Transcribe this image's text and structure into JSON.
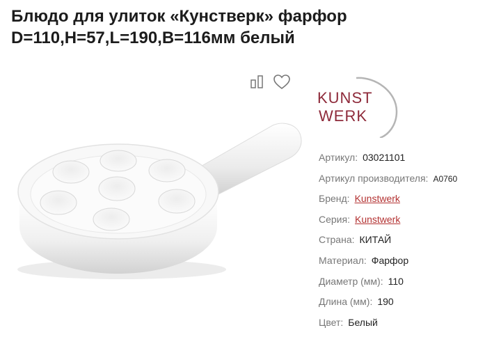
{
  "product": {
    "title": "Блюдо для улиток «Кунстверк» фарфор D=110,H=57,L=190,B=116мм белый"
  },
  "actions": {
    "compare_icon": "compare-icon",
    "favorite_icon": "heart-icon"
  },
  "brand_logo": {
    "line1": "KUNST",
    "line2": "WERK",
    "color": "#8e2a3a"
  },
  "specs": {
    "article": {
      "label": "Артикул:",
      "value": "03021101"
    },
    "manufacturer_article": {
      "label": "Артикул производителя:",
      "value": "A0760"
    },
    "brand": {
      "label": "Бренд:",
      "value": "Kunstwerk"
    },
    "series": {
      "label": "Серия:",
      "value": "Kunstwerk"
    },
    "country": {
      "label": "Страна:",
      "value": "КИТАЙ"
    },
    "material": {
      "label": "Материал:",
      "value": "Фарфор"
    },
    "diameter": {
      "label": "Диаметр (мм):",
      "value": "110"
    },
    "length": {
      "label": "Длина (мм):",
      "value": "190"
    },
    "color": {
      "label": "Цвет:",
      "value": "Белый"
    }
  },
  "colors": {
    "link": "#b33232",
    "label": "#777777",
    "text": "#222222"
  }
}
